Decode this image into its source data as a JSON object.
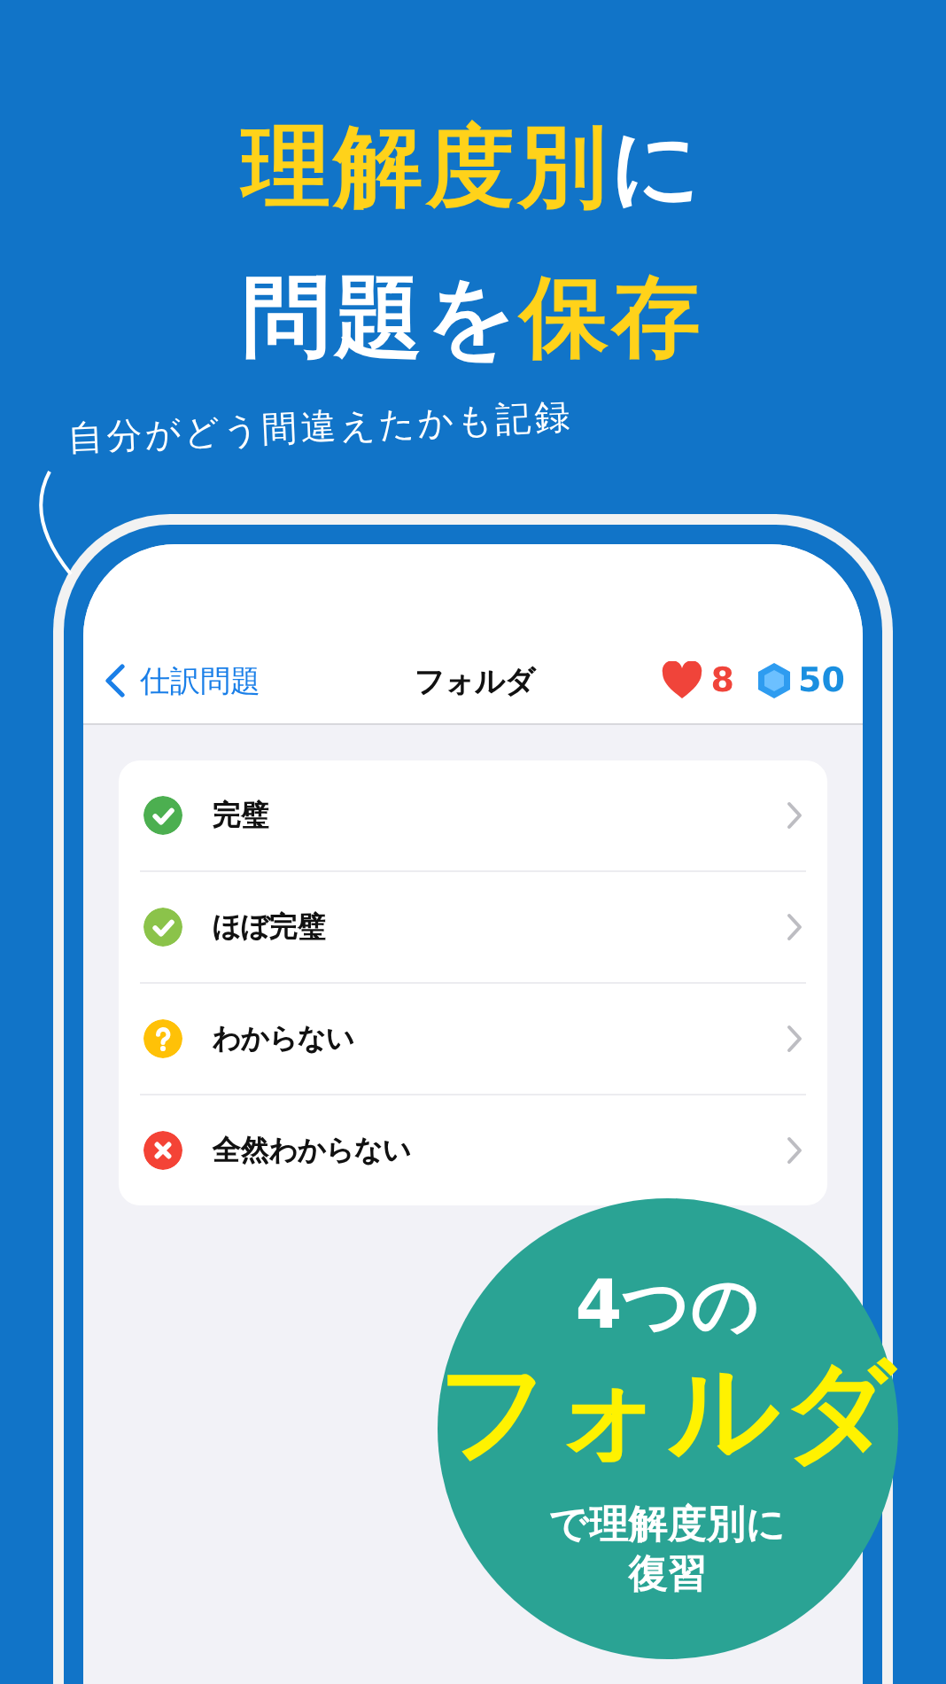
{
  "headline": [
    [
      {
        "text": "理解度別",
        "highlight": true
      },
      {
        "text": "に",
        "highlight": false
      }
    ],
    [
      {
        "text": "問題を",
        "highlight": false
      },
      {
        "text": "保存",
        "highlight": true
      }
    ]
  ],
  "caption": "自分がどう間違えたかも記録",
  "nav_bar": {
    "back": "仕訳問題",
    "title": "フォルダ",
    "hearts": "8",
    "gems": "50"
  },
  "folders": [
    {
      "label": "完璧",
      "kind": "check",
      "color": "#4caf50"
    },
    {
      "label": "ほぼ完璧",
      "kind": "check",
      "color": "#8bc34a"
    },
    {
      "label": "わからない",
      "kind": "question",
      "color": "#ffc107"
    },
    {
      "label": "全然わからない",
      "kind": "cross",
      "color": "#f44336"
    }
  ],
  "badge": {
    "line_1": "4つの",
    "line_2": "フォルダ",
    "line_3": "で理解度別に",
    "line_4": "復習"
  }
}
